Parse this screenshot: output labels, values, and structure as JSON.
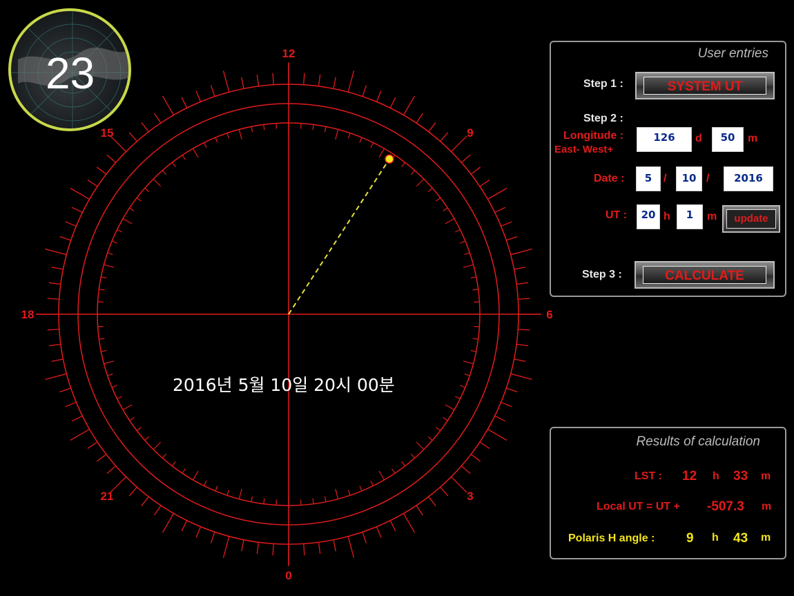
{
  "badge": {
    "number": "23"
  },
  "dial": {
    "hour_labels": [
      {
        "text": "12",
        "angle": 0
      },
      {
        "text": "9",
        "angle": 45
      },
      {
        "text": "6",
        "angle": 90
      },
      {
        "text": "3",
        "angle": 135
      },
      {
        "text": "0",
        "angle": 180
      },
      {
        "text": "21",
        "angle": 225
      },
      {
        "text": "18",
        "angle": 270
      },
      {
        "text": "15",
        "angle": 315
      }
    ],
    "polaris_angle_deg": 33,
    "date_text": "2016년 5월 10일 20시 00분"
  },
  "entries": {
    "title": "User entries",
    "step1_label": "Step 1 :",
    "system_ut_label": "SYSTEM UT",
    "step2_label": "Step 2 :",
    "longitude_label": "Longitude :",
    "east_west_label": "East- West+",
    "longitude_d": "126",
    "d_unit": "d",
    "longitude_m": "50",
    "m_unit": "m",
    "date_label": "Date :",
    "date_month": "5",
    "date_sep1": "/",
    "date_day": "10",
    "date_sep2": "/",
    "date_year": "2016",
    "ut_label": "UT :",
    "ut_h": "20",
    "h_unit": "h",
    "ut_m": "1",
    "ut_m_unit": "m",
    "update_label": "update",
    "step3_label": "Step 3 :",
    "calculate_label": "CALCULATE"
  },
  "results": {
    "title": "Results of  calculation",
    "lst_label": "LST  :",
    "lst_h": "12",
    "lst_h_unit": "h",
    "lst_m": "33",
    "lst_m_unit": "m",
    "local_ut_label": "Local UT = UT +",
    "local_ut_value": "-507.3",
    "local_ut_unit": "m",
    "polaris_label": "Polaris H angle :",
    "polaris_h": "9",
    "polaris_h_unit": "h",
    "polaris_m": "43",
    "polaris_m_unit": "m"
  },
  "colors": {
    "accent_red": "#e21b1b",
    "highlight_yellow": "#f3e51c"
  }
}
